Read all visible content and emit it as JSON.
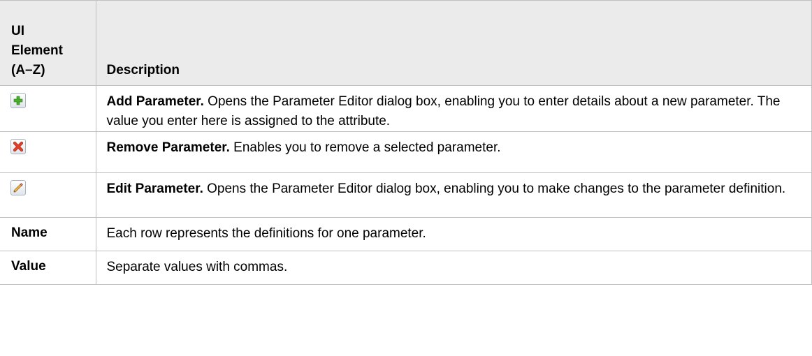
{
  "table": {
    "header": {
      "element_col": [
        "UI",
        "Element",
        "(A–Z)"
      ],
      "description_col": "Description"
    },
    "rows": [
      {
        "icon": "add-parameter-icon",
        "term": "Add Parameter.",
        "text": " Opens the Parameter Editor dialog box, enabling you to enter details about a new parameter. The value you enter here is assigned to the attribute."
      },
      {
        "icon": "remove-parameter-icon",
        "term": "Remove Parameter.",
        "text": " Enables you to remove a selected parameter."
      },
      {
        "icon": "edit-parameter-icon",
        "term": "Edit Parameter.",
        "text": " Opens the Parameter Editor dialog box, enabling you to make changes to the parameter definition."
      },
      {
        "element": "Name",
        "text": "Each row represents the definitions for one parameter."
      },
      {
        "element": "Value",
        "text": "Separate values with commas."
      }
    ]
  },
  "colors": {
    "header_bg": "#ebebeb",
    "border": "#c0c0c0",
    "add_green": "#4caf2e",
    "remove_red": "#e0402a",
    "edit_pencil": "#e8b64a"
  }
}
